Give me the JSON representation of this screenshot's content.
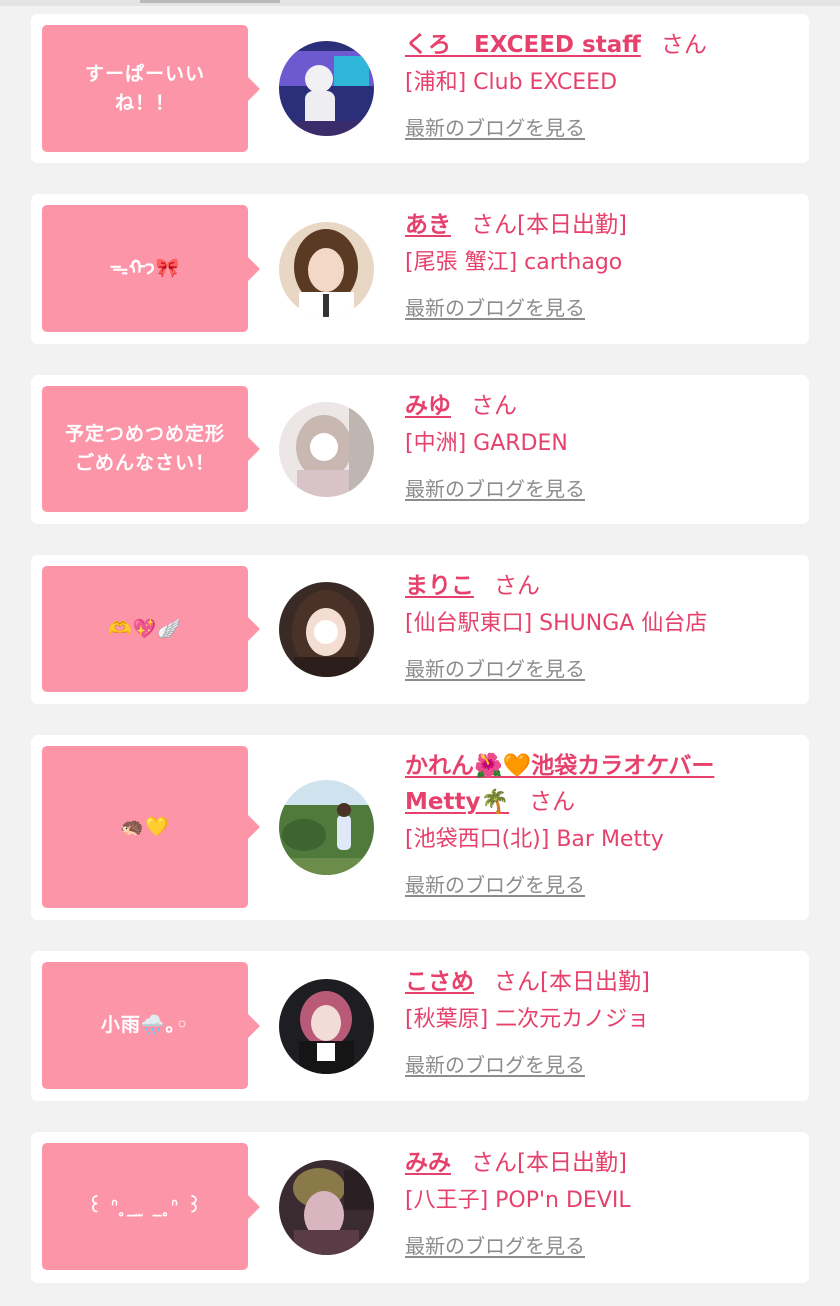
{
  "blog_link_label": "最新のブログを見る",
  "colors": {
    "accent": "#e6416c",
    "bubble": "#fd95a9",
    "link_gray": "#8c8c8c",
    "background": "#f2f2f2"
  },
  "entries": [
    {
      "message": "すーぱーいい\nね！！",
      "name": "くろ　EXCEED staff",
      "honorific": "さん",
      "attendance": "",
      "shop": "[浦和] Club EXCEED"
    },
    {
      "message": "ᯓᡣ𐭩🎀",
      "name": "あき",
      "honorific": "さん",
      "attendance": "[本日出勤]",
      "shop": "[尾張 蟹江] carthago"
    },
    {
      "message": "予定つめつめ定形\nごめんなさい！",
      "name": "みゆ",
      "honorific": "さん",
      "attendance": "",
      "shop": "[中洲] GARDEN"
    },
    {
      "message": "🫶💖🪽",
      "name": "まりこ",
      "honorific": "さん",
      "attendance": "",
      "shop": "[仙台駅東口] SHUNGA 仙台店"
    },
    {
      "message": "🦔💛",
      "name": "かれん🌺🧡池袋カラオケバーMetty🌴",
      "honorific": "さん",
      "attendance": "",
      "shop": "[池袋西口(北)] Bar Metty"
    },
    {
      "message": "小雨🌧️｡◦",
      "name": "こさめ",
      "honorific": "さん",
      "attendance": "[本日出勤]",
      "shop": "[秋葉原] 二次元カノジョ"
    },
    {
      "message": "꒰ ᐢ ̥_ ̫ _ ̥ᐢ ꒱",
      "name": "みみ",
      "honorific": "さん",
      "attendance": "[本日出勤]",
      "shop": "[八王子] POP'n DEVIL"
    }
  ]
}
